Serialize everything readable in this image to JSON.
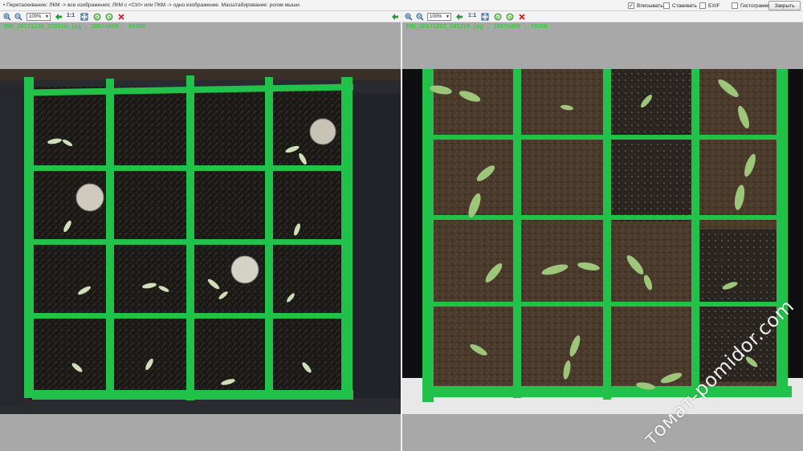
{
  "topbar": {
    "hint": "• Перетаскивание: ЛКМ -> все изображения; ЛКМ с <Ctrl> или ПКМ -> одно изображение. Масштабирование: ролик мыши.",
    "fit_label": "Вписывать",
    "fit_checked": true,
    "compare_label": "Стакивать",
    "compare_checked": false,
    "exif_label": "EXIF",
    "exif_checked": false,
    "histogram_label": "Гистограмма",
    "histogram_checked": false,
    "close_label": "Закрыть"
  },
  "left_pane": {
    "toolbar": {
      "zoom_value": "100%",
      "ratio_label": "1:1"
    },
    "caption": "IMG_20171130_123410.jpg , 1067x800 , 493KB"
  },
  "right_pane": {
    "toolbar": {
      "zoom_value": "100%",
      "ratio_label": "1:1"
    },
    "caption": "IMG_20171202_101219.jpg , 1067x800 , 552KB"
  },
  "watermark": "томат-pomidor.com",
  "colors": {
    "frame_green": "#22c24a",
    "caption_green": "#1ed11e",
    "dark_soil": "#1c1a17",
    "brown_soil": "#4a3a2c",
    "grey_bg": "#a8a8a8"
  },
  "icons": [
    "zoom-in-icon",
    "zoom-out-icon",
    "zoom-select",
    "arrow-icon",
    "actual-size-icon",
    "fit-icon",
    "rotate-left-icon",
    "rotate-right-icon",
    "close-icon"
  ]
}
